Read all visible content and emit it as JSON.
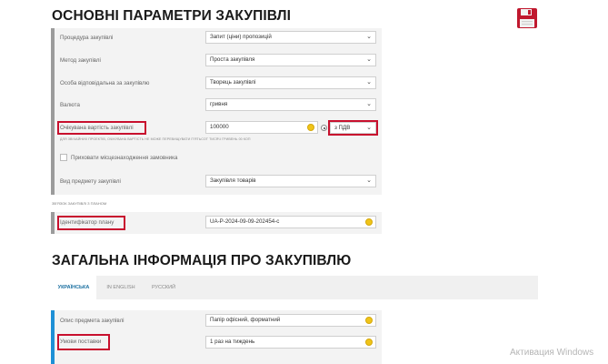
{
  "section1": {
    "title": "ОСНОВНІ ПАРАМЕТРИ ЗАКУПІВЛІ",
    "fields": [
      {
        "label": "Процедура закупівлі",
        "value": "Запит (ціни) пропозицій"
      },
      {
        "label": "Метод закупівлі",
        "value": "Проста закупівля"
      },
      {
        "label": "Особа відповідальна за закупівлю",
        "value": "Творець закупівлі"
      },
      {
        "label": "Валюта",
        "value": "гривня"
      },
      {
        "label": "Очікувана вартість закупівлі",
        "value": "100000"
      },
      {
        "label": "Вид предмету закупівлі",
        "value": "Закупівля товарів"
      }
    ],
    "vat_value": "з ПДВ",
    "hint": "ДЛЯ ЗВІЧАЙНИХ ПРОЕКТІВ, ОЧІКУВАНА ВАРТІСТЬ НЕ МОЖЕ ПЕРЕВИЩУВАТИ П'ЯТЬСОТ ТИСЯЧ ГРИВЕНЬ 00 КОП",
    "hide_location_label": "Приховати місцезнаходження замовника",
    "linked_label": "ЗВ'ЯЗОК ЗАКУПІВЛІ З ПЛАНОМ",
    "plan": {
      "label": "Ідентифікатор плану",
      "value": "UA-P-2024-09-09-202454-c"
    }
  },
  "section2": {
    "title": "ЗАГАЛЬНА ІНФОРМАЦІЯ ПРО ЗАКУПІВЛЮ",
    "tabs": [
      {
        "label": "УКРАЇНСЬКА"
      },
      {
        "label": "IN ENGLISH"
      },
      {
        "label": "РУССКИЙ"
      }
    ],
    "fields": [
      {
        "label": "Опис предмета закупівлі",
        "value": "Папір офісний, форматний"
      },
      {
        "label": "Умови поставки",
        "value": "1 раз на тиждень"
      }
    ]
  },
  "watermark": "Активация Windows",
  "colors": {
    "highlight": "#c8102e",
    "accent": "#1e90d6",
    "coin": "#f0c419"
  }
}
